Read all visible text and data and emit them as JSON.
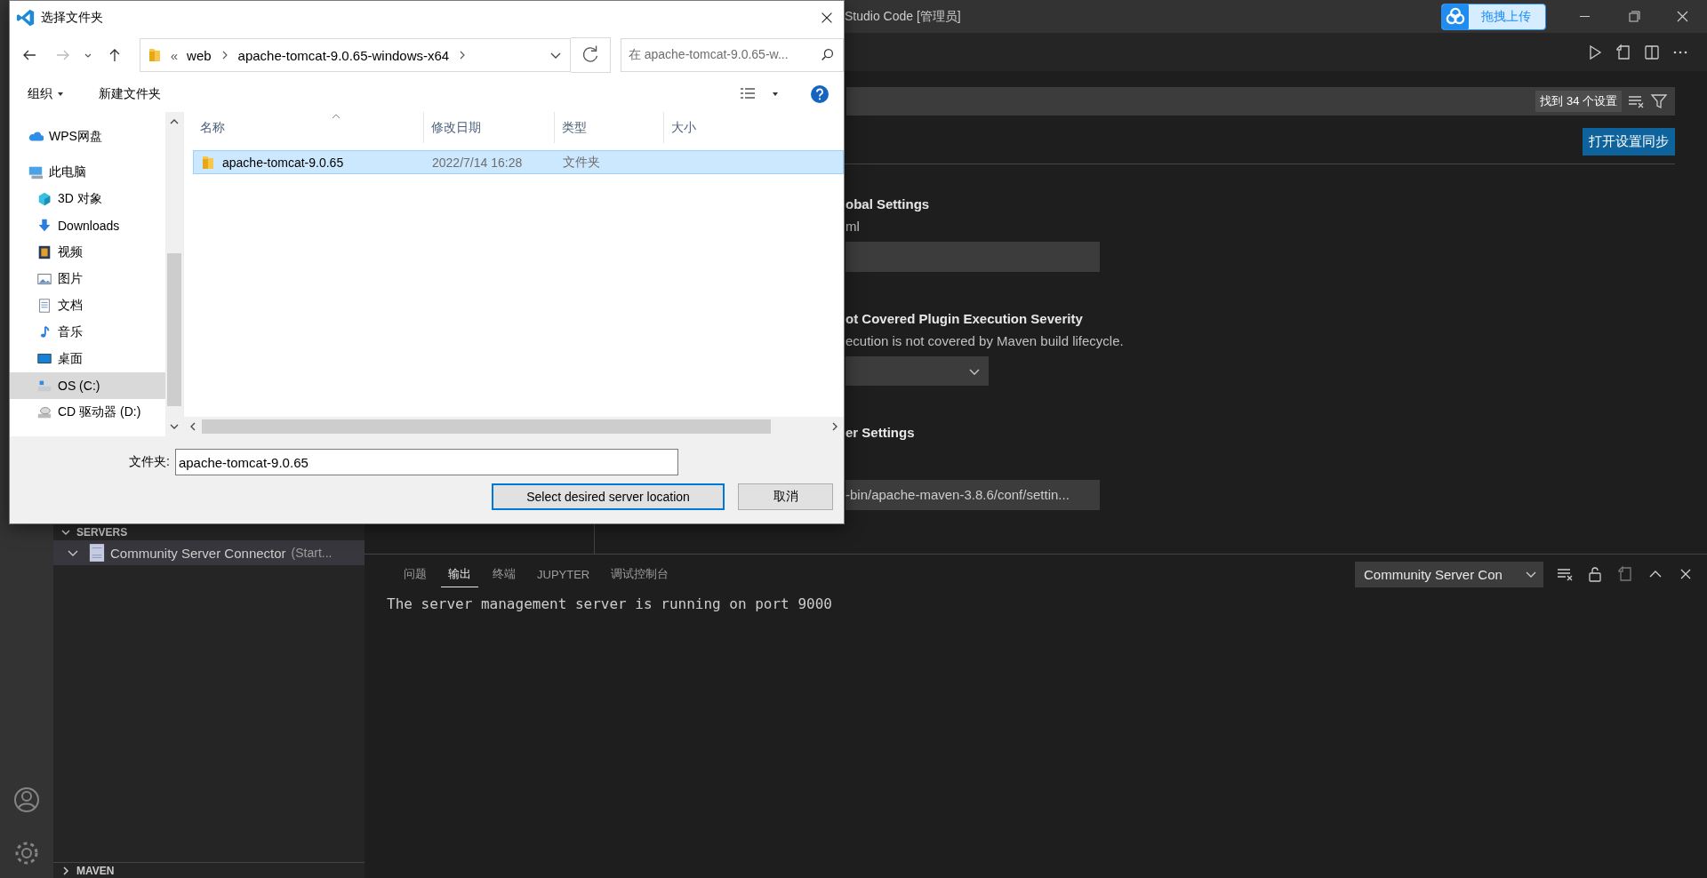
{
  "vscode": {
    "title": "Studio Code [管理员]",
    "upload_widget": {
      "label": "拖拽上传"
    },
    "sidebar": {
      "sections": [
        {
          "title": "SERVERS",
          "expanded": true,
          "items": [
            {
              "label": "Community Server Connector",
              "status": "(Start...",
              "expanded": true,
              "selected": true
            }
          ]
        },
        {
          "title": "MAVEN",
          "expanded": false
        }
      ]
    },
    "settings": {
      "result_count": "找到 34 个设置",
      "sync_button": "打开设置同步",
      "items": [
        {
          "kind": "input",
          "title": "obal Settings",
          "description": "ml"
        },
        {
          "kind": "select",
          "title": "ot Covered Plugin Execution Severity",
          "description": "ecution is not covered by Maven build lifecycle."
        },
        {
          "kind": "input",
          "title": "er Settings",
          "value": "-bin/apache-maven-3.8.6/conf/settin..."
        }
      ]
    },
    "panel": {
      "tabs": [
        {
          "label": "问题",
          "selected": false
        },
        {
          "label": "输出",
          "selected": true
        },
        {
          "label": "终端",
          "selected": false
        },
        {
          "label": "JUPYTER",
          "selected": false
        },
        {
          "label": "调试控制台",
          "selected": false
        }
      ],
      "channel": "Community Server Con",
      "output": [
        "The server management server is running on port 9000"
      ]
    }
  },
  "dialog": {
    "title": "选择文件夹",
    "path_overflow": "«",
    "path": [
      "web",
      "apache-tomcat-9.0.65-windows-x64"
    ],
    "search_placeholder": "在 apache-tomcat-9.0.65-w...",
    "toolbar": {
      "organize": "组织",
      "new_folder": "新建文件夹"
    },
    "nav": [
      {
        "label": "WPS网盘",
        "kind": "cloud",
        "selected": false
      },
      {
        "label": "此电脑",
        "kind": "pc",
        "selected": false,
        "children": [
          {
            "label": "3D 对象",
            "kind": "cube",
            "selected": false
          },
          {
            "label": "Downloads",
            "kind": "download",
            "selected": false
          },
          {
            "label": "视频",
            "kind": "video",
            "selected": false
          },
          {
            "label": "图片",
            "kind": "picture",
            "selected": false
          },
          {
            "label": "文档",
            "kind": "document",
            "selected": false
          },
          {
            "label": "音乐",
            "kind": "music",
            "selected": false
          },
          {
            "label": "桌面",
            "kind": "desktop",
            "selected": false
          },
          {
            "label": "OS (C:)",
            "kind": "drive",
            "selected": true
          },
          {
            "label": "CD 驱动器 (D:)",
            "kind": "cd",
            "selected": false
          }
        ]
      }
    ],
    "columns": [
      "名称",
      "修改日期",
      "类型",
      "大小"
    ],
    "rows": [
      {
        "name": "apache-tomcat-9.0.65",
        "date": "2022/7/14 16:28",
        "type": "文件夹",
        "selected": true
      }
    ],
    "folder_label": "文件夹:",
    "folder_value": "apache-tomcat-9.0.65",
    "buttons": [
      {
        "label": "Select desired server location",
        "default": true
      },
      {
        "label": "取消",
        "default": false
      }
    ]
  }
}
